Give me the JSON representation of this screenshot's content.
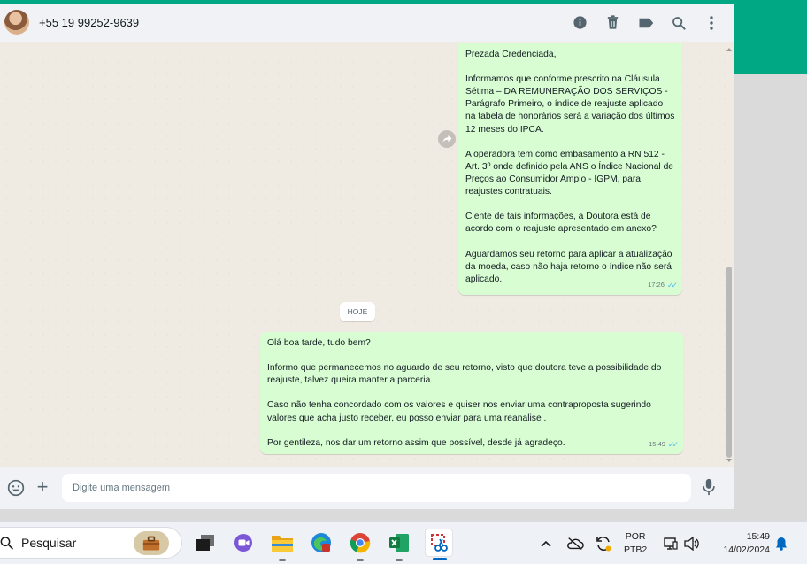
{
  "header": {
    "contact_name": "+55 19 99252-9639",
    "icons": [
      "info-icon",
      "trash-icon",
      "label-icon",
      "search-icon",
      "kebab-menu-icon"
    ]
  },
  "messages": [
    {
      "text": "Prezada Credenciada,\n\nInformamos que conforme prescrito na Cláusula Sétima – DA REMUNERAÇÃO DOS SERVIÇOS - Parágrafo Primeiro, o índice de reajuste aplicado na tabela de honorários será a variação dos últimos 12 meses do IPCA.\n\nA operadora tem como embasamento a RN 512 - Art. 3º onde definido pela ANS o Índice Nacional de Preços ao Consumidor Amplo - IGPM, para reajustes contratuais.\n\nCiente de tais informações, a Doutora está de acordo com o reajuste apresentado em anexo?\n\nAguardamos seu retorno para aplicar a atualização da moeda, caso não haja retorno o índice não será aplicado.",
      "time": "17:26"
    },
    {
      "text": "Olá boa tarde, tudo bem?\n\nInformo que permanecemos no aguardo de seu retorno, visto que doutora teve a possibilidade do reajuste, talvez queira manter a parceria.\n\nCaso não tenha concordado com os valores e quiser nos enviar uma contraproposta sugerindo valores que acha justo receber, eu posso enviar para uma reanalise .\n\nPor gentileza, nos dar um retorno assim que possível, desde já agradeço.",
      "time": "15:49"
    }
  ],
  "day_separator": "HOJE",
  "composer": {
    "placeholder": "Digite uma mensagem"
  },
  "taskbar": {
    "search_label": "Pesquisar",
    "apps": [
      "task-view",
      "teams",
      "file-explorer",
      "edge",
      "chrome",
      "excel",
      "snipping-tool"
    ],
    "lang_line1": "POR",
    "lang_line2": "PTB2",
    "time": "15:49",
    "date": "14/02/2024"
  },
  "colors": {
    "accent": "#00a884",
    "outgoing_bubble": "#d9fdd3",
    "chat_bg": "#efeae2",
    "read_ticks": "#53bdeb"
  }
}
